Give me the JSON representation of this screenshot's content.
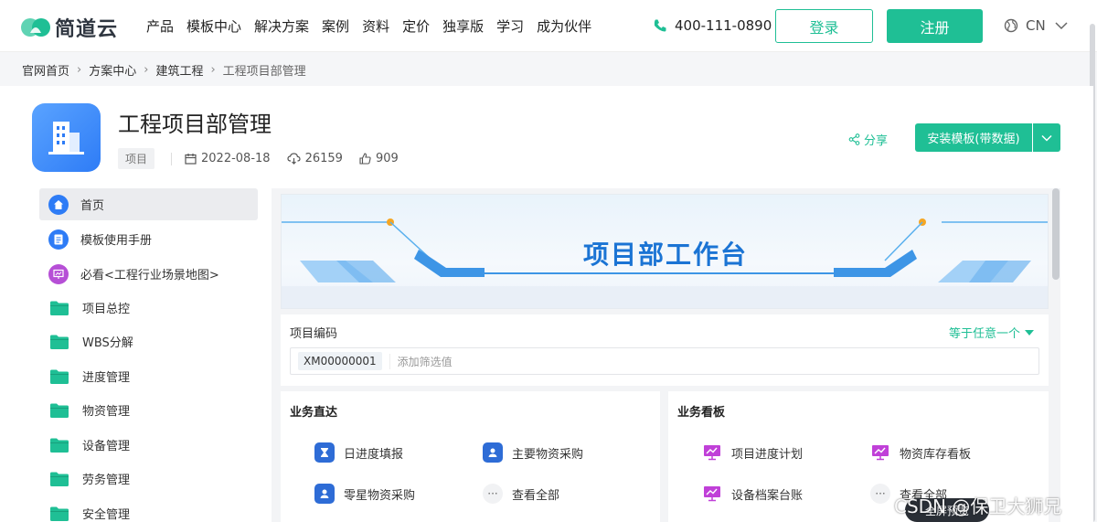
{
  "brand": {
    "name": "简道云",
    "accent": "#1fbf95"
  },
  "nav": {
    "items": [
      "产品",
      "模板中心",
      "解决方案",
      "案例",
      "资料",
      "定价",
      "独享版",
      "学习",
      "成为伙伴"
    ],
    "phone": "400-111-0890",
    "login": "登录",
    "register": "注册",
    "lang": "CN"
  },
  "breadcrumb": [
    "官网首页",
    "方案中心",
    "建筑工程",
    "工程项目部管理"
  ],
  "header": {
    "title": "工程项目部管理",
    "tag": "项目",
    "date": "2022-08-18",
    "downloads": "26159",
    "likes": "909",
    "share": "分享",
    "install": "安装模板(带数据)"
  },
  "sidebar": {
    "items": [
      {
        "label": "首页",
        "icon": "home-icon",
        "color": "#2e7cf6"
      },
      {
        "label": "模板使用手册",
        "icon": "document-icon",
        "color": "#2e7cf6"
      },
      {
        "label": "必看<工程行业场景地图>",
        "icon": "presentation-icon",
        "color": "#b64fd6"
      },
      {
        "label": "项目总控",
        "icon": "folder-icon"
      },
      {
        "label": "WBS分解",
        "icon": "folder-icon"
      },
      {
        "label": "进度管理",
        "icon": "folder-icon"
      },
      {
        "label": "物资管理",
        "icon": "folder-icon"
      },
      {
        "label": "设备管理",
        "icon": "folder-icon"
      },
      {
        "label": "劳务管理",
        "icon": "folder-icon"
      },
      {
        "label": "安全管理",
        "icon": "folder-icon"
      }
    ]
  },
  "banner": {
    "title": "项目部工作台"
  },
  "filter": {
    "label": "项目编码",
    "mode": "等于任意一个",
    "value": "XM00000001",
    "add_placeholder": "添加筛选值"
  },
  "cards": {
    "left": {
      "title": "业务直达",
      "items": [
        "日进度填报",
        "主要物资采购",
        "零星物资采购",
        "查看全部"
      ]
    },
    "right": {
      "title": "业务看板",
      "items": [
        "项目进度计划",
        "物资库存看板",
        "设备档案台账",
        "查看全部"
      ]
    }
  },
  "overlay": {
    "watermark": "CSDN @保卫大狮兄",
    "preview": "全屏预览"
  }
}
